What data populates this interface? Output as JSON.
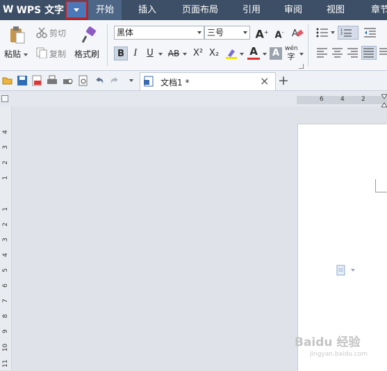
{
  "app": {
    "title": "WPS 文字",
    "logo_glyph": "W"
  },
  "menu": {
    "start": "开始",
    "insert": "插入",
    "layout": "页面布局",
    "references": "引用",
    "review": "审阅",
    "view": "视图",
    "chapter": "章节"
  },
  "ribbon": {
    "paste": "粘贴",
    "cut": "剪切",
    "copy": "复制",
    "format_painter": "格式刷",
    "font_name": "黑体",
    "font_size": "三号",
    "bold": "B",
    "italic": "I",
    "underline": "U",
    "strike": "AB",
    "superscript": "X²",
    "subscript": "X₂",
    "font_color": "A",
    "char_shade": "A",
    "phonetic": "wén"
  },
  "document": {
    "tab_name": "文档1",
    "modified_mark": "*",
    "new_tab": "+"
  },
  "ruler": {
    "horizontal_ticks": [
      "6",
      "4",
      "2"
    ],
    "vertical_ticks": [
      "4",
      "3",
      "2",
      "1",
      "1",
      "2",
      "3",
      "4",
      "5",
      "6",
      "7",
      "8",
      "9",
      "10",
      "11"
    ]
  },
  "watermark": {
    "main": "Baidu 经验",
    "sub": "jingyan.baidu.com"
  },
  "colors": {
    "titlebar": "#3d4f66",
    "active_tab": "#4d6685",
    "highlight_border": "#e01818"
  }
}
